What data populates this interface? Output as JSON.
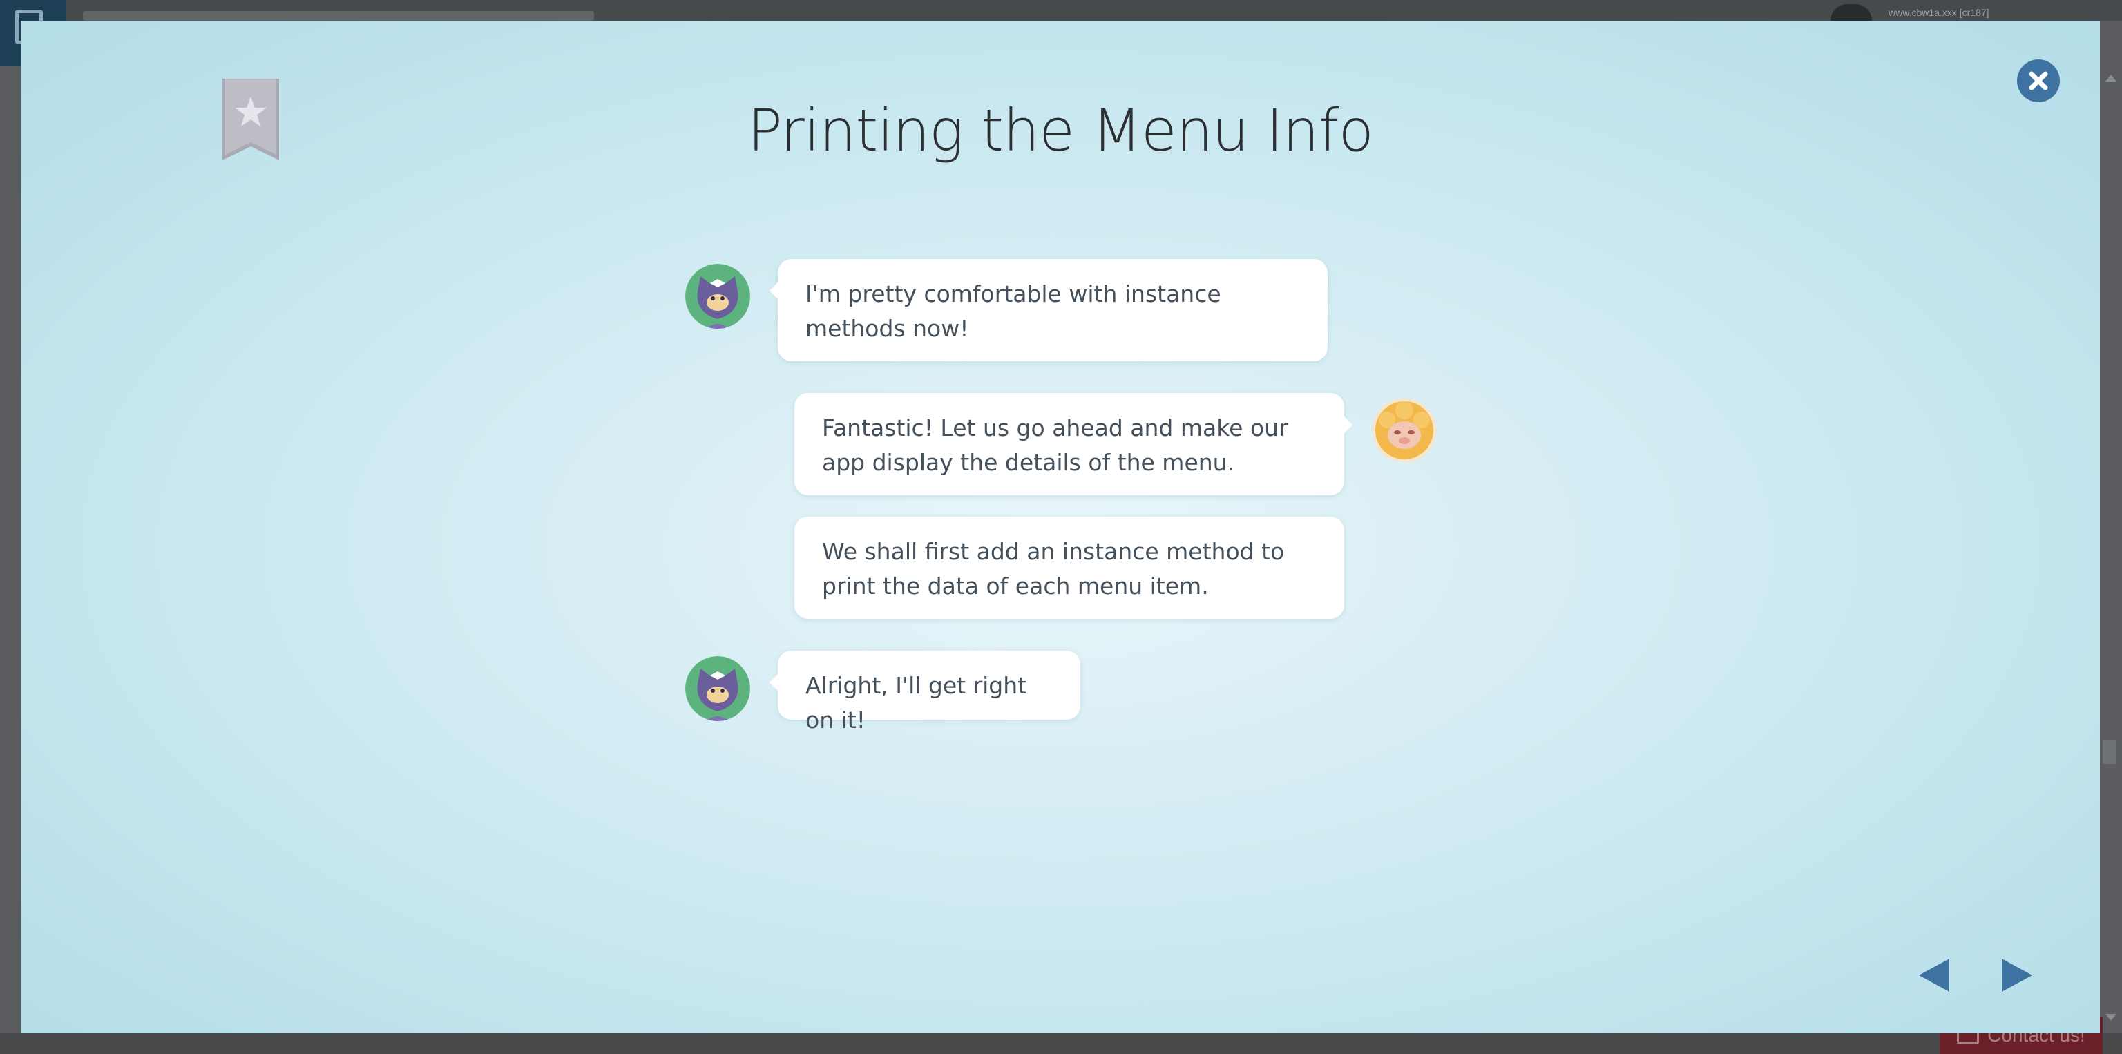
{
  "background": {
    "username": "www.cbw1a.xxx [cr187]",
    "contact_label": "Contact us!"
  },
  "modal": {
    "title": "Printing the Menu Info",
    "bookmark_icon": "bookmark-star-icon",
    "close_icon": "close-icon",
    "colors": {
      "close_button": "#3e72a0",
      "nav_arrow": "#3e72a0",
      "bubble": "#ffffff",
      "text": "#44505b"
    }
  },
  "chat": {
    "messages": [
      {
        "speaker": "cat",
        "side": "left",
        "text": "I'm pretty comfortable with instance methods now!"
      },
      {
        "speaker": "sheep",
        "side": "right",
        "text": "Fantastic! Let us go ahead and make our app display the details of the menu."
      },
      {
        "speaker": "sheep",
        "side": "right",
        "text": "We shall first add an instance method to print the data of each menu item."
      },
      {
        "speaker": "cat",
        "side": "left",
        "text": "Alright, I'll get right on it!"
      }
    ]
  },
  "navigation": {
    "prev_icon": "triangle-left-icon",
    "next_icon": "triangle-right-icon"
  }
}
